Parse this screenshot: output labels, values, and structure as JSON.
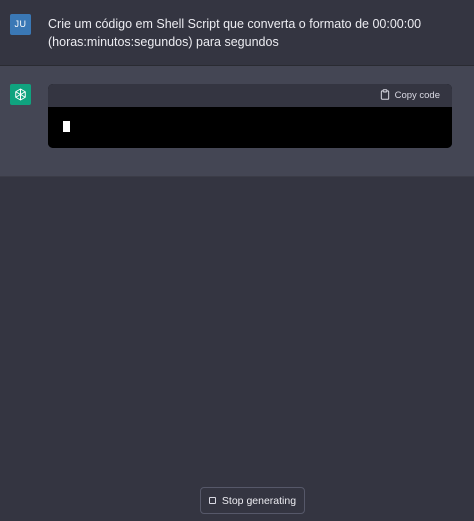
{
  "user_message": {
    "avatar_initials": "JU",
    "text": "Crie um código em Shell Script que converta o formato de 00:00:00 (horas:minutos:segundos) para segundos"
  },
  "assistant_message": {
    "avatar_icon": "openai-logo-icon",
    "code_block": {
      "copy_label": "Copy code",
      "copy_icon": "clipboard-icon"
    }
  },
  "footer": {
    "stop_label": "Stop generating",
    "stop_icon": "stop-square-icon"
  },
  "colors": {
    "background": "#343541",
    "assistant_background": "#444654",
    "user_avatar": "#3a78b5",
    "assistant_avatar": "#10a37f",
    "code_background": "#000000"
  }
}
